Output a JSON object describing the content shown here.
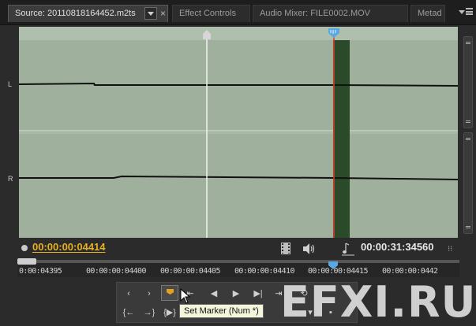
{
  "tabs": [
    {
      "label": "Source: 20110818164452.m2ts",
      "active": true
    },
    {
      "label": "Effect Controls",
      "active": false
    },
    {
      "label": "Audio Mixer: FILE0002.MOV",
      "active": false
    },
    {
      "label": "Metad",
      "active": false
    }
  ],
  "tab_close_glyph": "×",
  "channels": {
    "left": "L",
    "right": "R"
  },
  "timecode": {
    "current": "00:00:00:04414",
    "duration": "00:00:31:34560"
  },
  "ruler": {
    "labels": [
      "0:00:04395",
      "00:00:00:04400",
      "00:00:00:04405",
      "00:00:00:04410",
      "00:00:00:04415",
      "00:00:00:0442"
    ]
  },
  "tooltip": "Set Marker (Num *)",
  "watermark": "EFXI.RU",
  "colors": {
    "waveform_bg": "#9fb09d",
    "selection": "#2a4a2a",
    "playhead": "#e03a2a",
    "timecode": "#e6b022"
  }
}
